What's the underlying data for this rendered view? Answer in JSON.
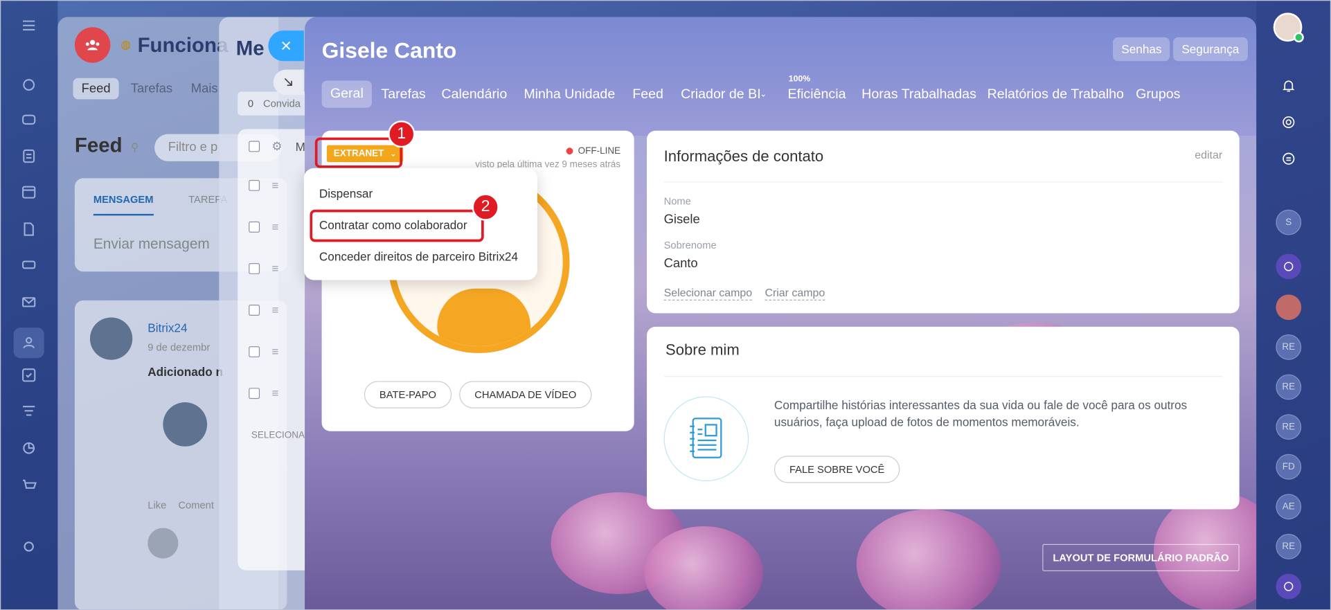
{
  "backpage": {
    "title_group": "Funciona",
    "tabs": [
      "Feed",
      "Tarefas",
      "Mais"
    ],
    "feed_title": "Feed",
    "filter_placeholder": "Filtro e p",
    "compose_tabs": [
      "MENSAGEM",
      "TAREFA"
    ],
    "compose_placeholder": "Enviar mensagem",
    "post_author": "Bitrix24",
    "post_date": "9 de dezembr",
    "post_text": "Adicionado n",
    "like_label": "Like",
    "comment_label": "Coment"
  },
  "midslider": {
    "title": "Me",
    "invite_count": "0",
    "invite_label": "Convida",
    "select_label": "SELECIONA",
    "column_label": "M"
  },
  "main": {
    "user_name": "Gisele Canto",
    "header_buttons": [
      "Senhas",
      "Segurança"
    ],
    "tabs": [
      "Geral",
      "Tarefas",
      "Calendário",
      "Minha Unidade",
      "Feed",
      "Criador de BI",
      "Eficiência",
      "Horas Trabalhadas",
      "Relatórios de Trabalho",
      "Grupos"
    ],
    "efficiency_badge": "100%"
  },
  "profile": {
    "role_badge": "EXTRANET",
    "status": "OFF-LINE",
    "last_seen": "visto pela última vez 9 meses atrás",
    "chat_button": "BATE-PAPO",
    "video_button": "CHAMADA DE VÍDEO"
  },
  "annotations": {
    "badge1": "1",
    "badge2": "2"
  },
  "menu": {
    "items": [
      "Dispensar",
      "Contratar como colaborador",
      "Conceder direitos de parceiro Bitrix24"
    ]
  },
  "contact": {
    "title": "Informações de contato",
    "edit_link": "editar",
    "first_name_label": "Nome",
    "first_name": "Gisele",
    "last_name_label": "Sobrenome",
    "last_name": "Canto",
    "select_field": "Selecionar campo",
    "create_field": "Criar campo"
  },
  "about": {
    "title": "Sobre mim",
    "text": "Compartilhe histórias interessantes da sua vida ou fale de você para os outros usuários, faça upload de fotos de momentos memoráveis.",
    "button": "FALE SOBRE VOCÊ"
  },
  "layout_button": "LAYOUT DE FORMULÁRIO PADRÃO",
  "rightrail": {
    "initials": [
      "S",
      "RE",
      "RE",
      "RE",
      "FD",
      "AE",
      "RE"
    ]
  },
  "colors": {
    "accent": "#2fa6ff",
    "extranet": "#f2a71c",
    "annotation": "#e01b23",
    "offline": "#ef4444"
  }
}
